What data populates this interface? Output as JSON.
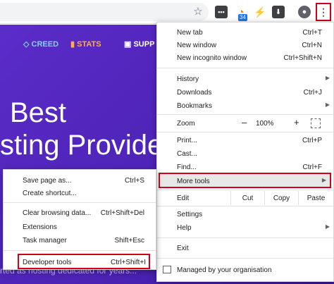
{
  "toolbar": {
    "ext1_label": "•••",
    "ext2_badge": "34",
    "ext3_glyph": "⚡",
    "ext4_glyph": "⬇",
    "menu_glyph": "⋮"
  },
  "page": {
    "nav": [
      {
        "label": "CREED",
        "icon": "diamond-icon"
      },
      {
        "label": "STATS",
        "icon": "bar-chart-icon"
      },
      {
        "label": "SUPP",
        "icon": "briefcase-icon"
      }
    ],
    "hero_line1": "Best",
    "hero_line2": "sting Provide",
    "hero_line3": "rted as hosting dedicated for years..."
  },
  "main_menu": {
    "new_tab": {
      "label": "New tab",
      "shortcut": "Ctrl+T"
    },
    "new_window": {
      "label": "New window",
      "shortcut": "Ctrl+N"
    },
    "new_incognito": {
      "label": "New incognito window",
      "shortcut": "Ctrl+Shift+N"
    },
    "history": {
      "label": "History"
    },
    "downloads": {
      "label": "Downloads",
      "shortcut": "Ctrl+J"
    },
    "bookmarks": {
      "label": "Bookmarks"
    },
    "zoom": {
      "label": "Zoom",
      "minus": "–",
      "value": "100%",
      "plus": "+"
    },
    "print": {
      "label": "Print...",
      "shortcut": "Ctrl+P"
    },
    "cast": {
      "label": "Cast..."
    },
    "find": {
      "label": "Find...",
      "shortcut": "Ctrl+F"
    },
    "more_tools": {
      "label": "More tools"
    },
    "edit": {
      "label": "Edit",
      "cut": "Cut",
      "copy": "Copy",
      "paste": "Paste"
    },
    "settings": {
      "label": "Settings"
    },
    "help": {
      "label": "Help"
    },
    "exit": {
      "label": "Exit"
    },
    "managed": {
      "label": "Managed by your organisation"
    }
  },
  "sub_menu": {
    "save_page": {
      "label": "Save page as...",
      "shortcut": "Ctrl+S"
    },
    "create_shortcut": {
      "label": "Create shortcut..."
    },
    "clear_data": {
      "label": "Clear browsing data...",
      "shortcut": "Ctrl+Shift+Del"
    },
    "extensions": {
      "label": "Extensions"
    },
    "task_manager": {
      "label": "Task manager",
      "shortcut": "Shift+Esc"
    },
    "dev_tools": {
      "label": "Developer tools",
      "shortcut": "Ctrl+Shift+I"
    }
  },
  "colors": {
    "highlight": "#d0021b",
    "page_bg": "#4b22b3",
    "creed": "#7fd3ff",
    "stats": "#ffb13b"
  }
}
